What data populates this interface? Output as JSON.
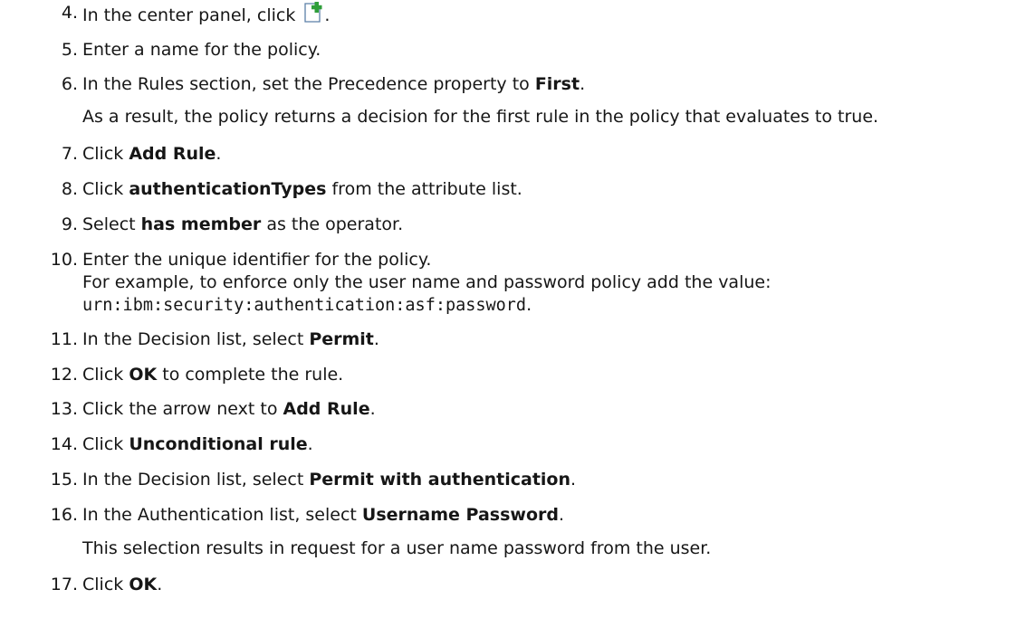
{
  "steps": [
    {
      "num": "4.",
      "pre": "In the center panel, click",
      "post": "."
    },
    {
      "num": "5.",
      "text": "Enter a name for the policy."
    },
    {
      "num": "6.",
      "pre": "In the Rules section, set the Precedence property to ",
      "bold": "First",
      "post": ".",
      "note": "As a result, the policy returns a decision for the first rule in the policy that evaluates to true."
    },
    {
      "num": "7.",
      "pre": "Click ",
      "bold": "Add Rule",
      "post": "."
    },
    {
      "num": "8.",
      "pre": "Click ",
      "bold": "authenticationTypes",
      "post": " from the attribute list."
    },
    {
      "num": "9.",
      "pre": "Select ",
      "bold": "has member",
      "post": " as the operator."
    },
    {
      "num": "10.",
      "text": "Enter the unique identifier for the policy.",
      "line2": "For example, to enforce only the user name and password policy add the value:",
      "code": "urn:ibm:security:authentication:asf:password",
      "code_post": "."
    },
    {
      "num": "11.",
      "pre": "In the Decision list, select ",
      "bold": "Permit",
      "post": "."
    },
    {
      "num": "12.",
      "pre": "Click ",
      "bold": "OK",
      "post": " to complete the rule."
    },
    {
      "num": "13.",
      "pre": "Click the arrow next to ",
      "bold": "Add Rule",
      "post": "."
    },
    {
      "num": "14.",
      "pre": "Click ",
      "bold": "Unconditional rule",
      "post": "."
    },
    {
      "num": "15.",
      "pre": "In the Decision list, select ",
      "bold": "Permit with authentication",
      "post": "."
    },
    {
      "num": "16.",
      "pre": "In the Authentication list, select ",
      "bold": "Username Password",
      "post": ".",
      "note": "This selection results in request for a user name password from the user."
    },
    {
      "num": "17.",
      "pre": "Click ",
      "bold": "OK",
      "post": "."
    }
  ],
  "icons": {
    "add_policy": "new-document-plus-icon"
  }
}
